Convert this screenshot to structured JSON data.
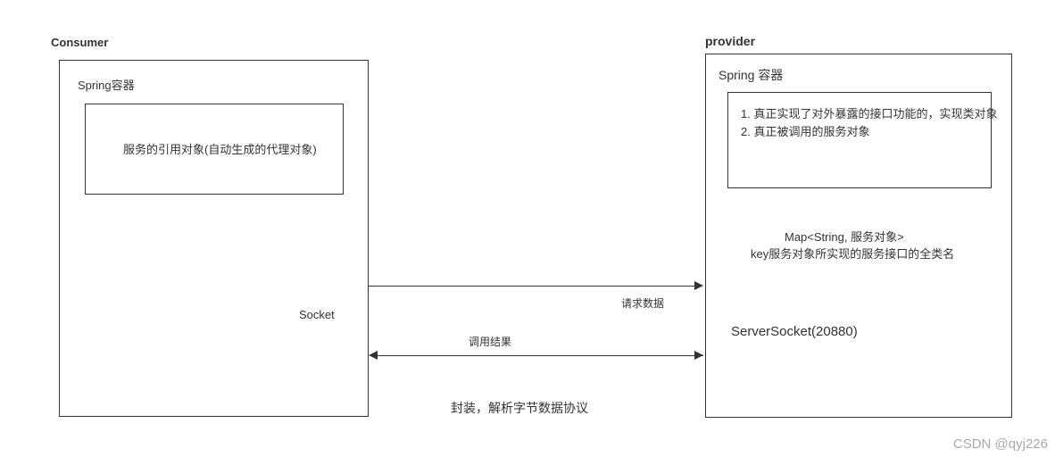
{
  "consumer": {
    "title": "Consumer",
    "container_label": "Spring容器",
    "inner_box_text": "服务的引用对象(自动生成的代理对象)",
    "socket_label": "Socket"
  },
  "provider": {
    "title": "provider",
    "container_label": "Spring 容器",
    "inner_box_line1": "1. 真正实现了对外暴露的接口功能的，实现类对象",
    "inner_box_line2": "2. 真正被调用的服务对象",
    "map_line1": "Map<String, 服务对象>",
    "map_line2": "key服务对象所实现的服务接口的全类名",
    "server_socket_label": "ServerSocket(20880)"
  },
  "arrows": {
    "request_label": "请求数据",
    "result_label": "调用结果",
    "protocol_label": "封装，解析字节数据协议"
  },
  "watermark": "CSDN @qyj226"
}
